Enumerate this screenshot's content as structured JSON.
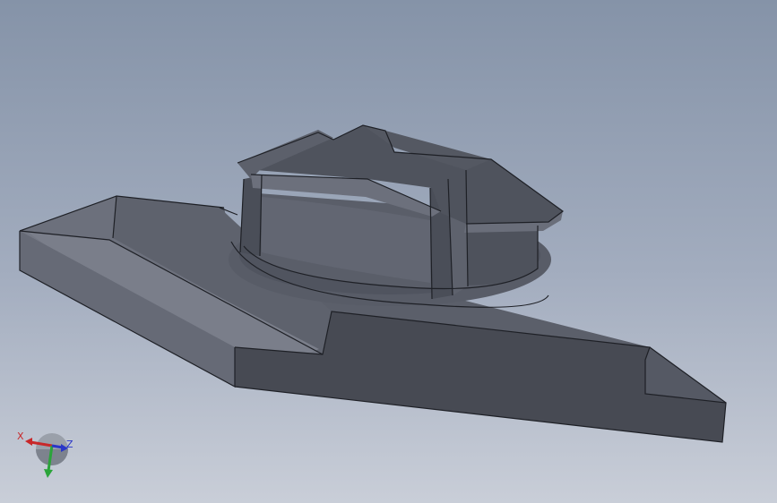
{
  "viewport": {
    "background_top": "#8593a8",
    "background_bottom": "#c9ced8",
    "model_color": "#4a4e58"
  },
  "triad": {
    "x_label": "X",
    "z_label": "Z",
    "x_color": "#c8282a",
    "y_color": "#2aa43a",
    "z_color": "#2a36c8"
  }
}
